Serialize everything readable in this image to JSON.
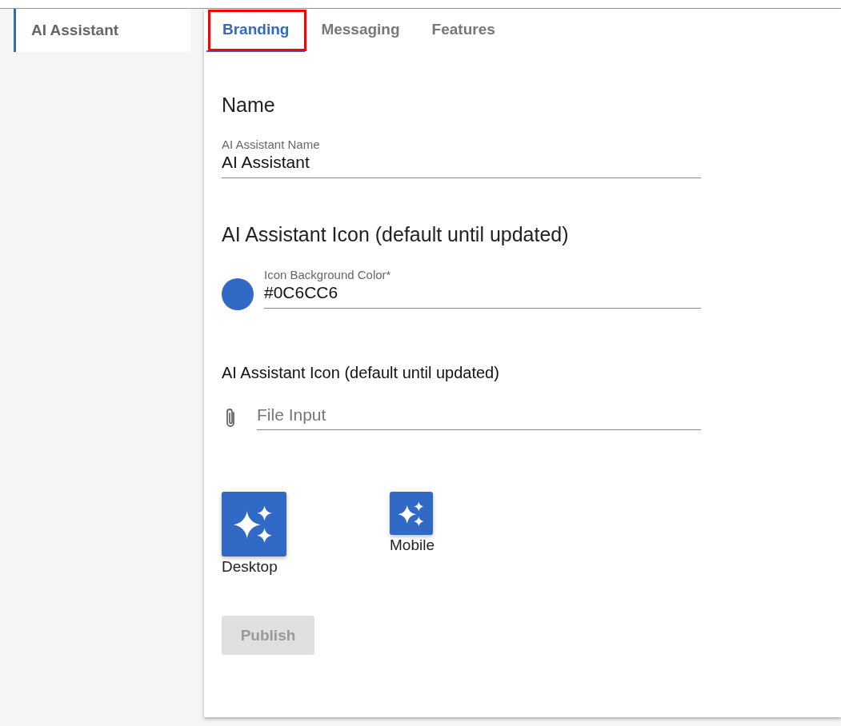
{
  "sidebar": {
    "items": [
      {
        "label": "AI Assistant",
        "selected": true
      }
    ]
  },
  "tabs": [
    {
      "label": "Branding",
      "selected": true,
      "highlighted": true
    },
    {
      "label": "Messaging",
      "selected": false,
      "highlighted": false
    },
    {
      "label": "Features",
      "selected": false,
      "highlighted": false
    }
  ],
  "name_section": {
    "title": "Name",
    "field": {
      "label": "AI Assistant Name",
      "value": "AI Assistant"
    }
  },
  "icon_section": {
    "title": "AI Assistant Icon (default until updated)",
    "color_field": {
      "label": "Icon Background Color*",
      "value": "#0C6CC6",
      "color": "#316ac6"
    },
    "upload_title": "AI Assistant Icon (default until updated)",
    "file_field": {
      "placeholder": "File Input"
    },
    "previews": [
      {
        "kind": "desktop",
        "label": "Desktop"
      },
      {
        "kind": "mobile",
        "label": "Mobile"
      }
    ]
  },
  "publish_button": {
    "label": "Publish",
    "disabled": true
  }
}
